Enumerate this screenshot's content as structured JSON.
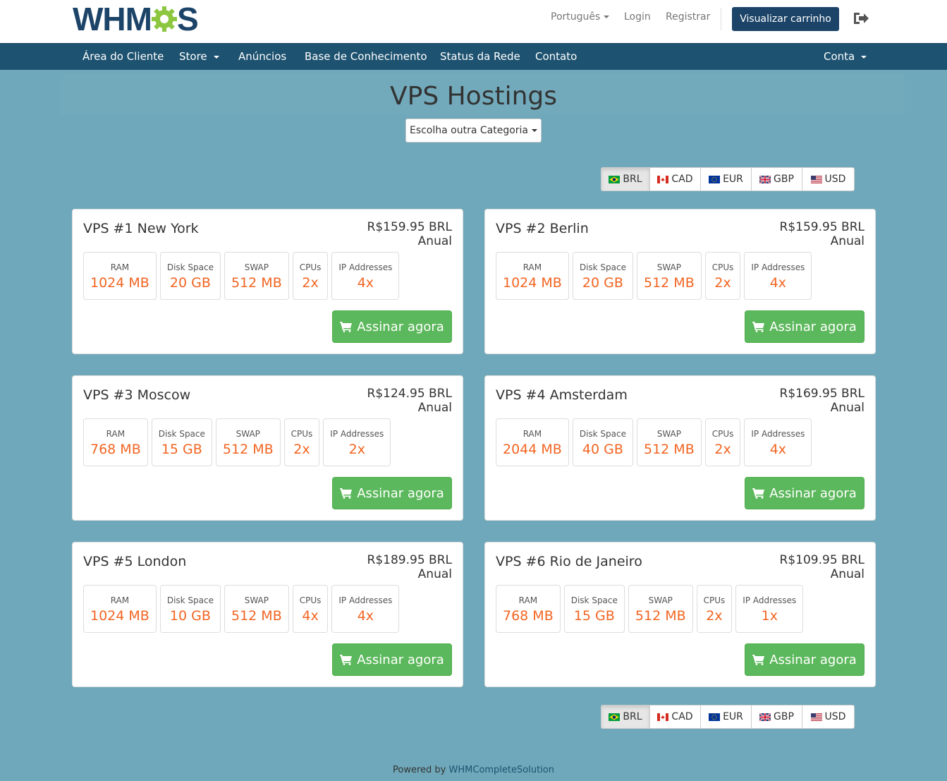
{
  "header": {
    "logo_text_left": "WHM",
    "logo_text_right": "S",
    "language_label": "Português",
    "login_label": "Login",
    "register_label": "Registrar",
    "cart_label": "Visualizar carrinho"
  },
  "nav": {
    "items": [
      {
        "label": "Área do Cliente"
      },
      {
        "label": "Store"
      },
      {
        "label": "Anúncios"
      },
      {
        "label": "Base de Conhecimento"
      },
      {
        "label": "Status da Rede"
      },
      {
        "label": "Contato"
      }
    ],
    "account_label": "Conta"
  },
  "page": {
    "title": "VPS Hostings",
    "category_button": "Escolha outra Categoria"
  },
  "currencies": [
    {
      "code": "BRL",
      "flag": "brazil-flag-icon",
      "active": true
    },
    {
      "code": "CAD",
      "flag": "canada-flag-icon",
      "active": false
    },
    {
      "code": "EUR",
      "flag": "eu-flag-icon",
      "active": false
    },
    {
      "code": "GBP",
      "flag": "uk-flag-icon",
      "active": false
    },
    {
      "code": "USD",
      "flag": "us-flag-icon",
      "active": false
    }
  ],
  "spec_labels": {
    "ram": "RAM",
    "disk": "Disk Space",
    "swap": "SWAP",
    "cpus": "CPUs",
    "ip": "IP Addresses"
  },
  "products": [
    {
      "name": "VPS #1 New York",
      "price": "R$159.95 BRL",
      "cycle": "Anual",
      "ram": "1024 MB",
      "disk": "20 GB",
      "swap": "512 MB",
      "cpus": "2x",
      "ip": "4x",
      "button": "Assinar agora"
    },
    {
      "name": "VPS #2 Berlin",
      "price": "R$159.95 BRL",
      "cycle": "Anual",
      "ram": "1024 MB",
      "disk": "20 GB",
      "swap": "512 MB",
      "cpus": "2x",
      "ip": "4x",
      "button": "Assinar agora"
    },
    {
      "name": "VPS #3 Moscow",
      "price": "R$124.95 BRL",
      "cycle": "Anual",
      "ram": "768 MB",
      "disk": "15 GB",
      "swap": "512 MB",
      "cpus": "2x",
      "ip": "2x",
      "button": "Assinar agora"
    },
    {
      "name": "VPS #4 Amsterdam",
      "price": "R$169.95 BRL",
      "cycle": "Anual",
      "ram": "2044 MB",
      "disk": "40 GB",
      "swap": "512 MB",
      "cpus": "2x",
      "ip": "4x",
      "button": "Assinar agora"
    },
    {
      "name": "VPS #5 London",
      "price": "R$189.95 BRL",
      "cycle": "Anual",
      "ram": "1024 MB",
      "disk": "10 GB",
      "swap": "512 MB",
      "cpus": "4x",
      "ip": "4x",
      "button": "Assinar agora"
    },
    {
      "name": "VPS #6 Rio de Janeiro",
      "price": "R$109.95 BRL",
      "cycle": "Anual",
      "ram": "768 MB",
      "disk": "15 GB",
      "swap": "512 MB",
      "cpus": "2x",
      "ip": "1x",
      "button": "Assinar agora"
    }
  ],
  "footer": {
    "prefix": "Powered by",
    "link": "WHMCompleteSolution"
  },
  "colors": {
    "brand_dark": "#1c4468",
    "nav_bg": "#1d5270",
    "page_bg": "#6fa8ba",
    "price_orange": "#f26522",
    "buy_green": "#5cb85c",
    "logo_green": "#8dc63f"
  }
}
